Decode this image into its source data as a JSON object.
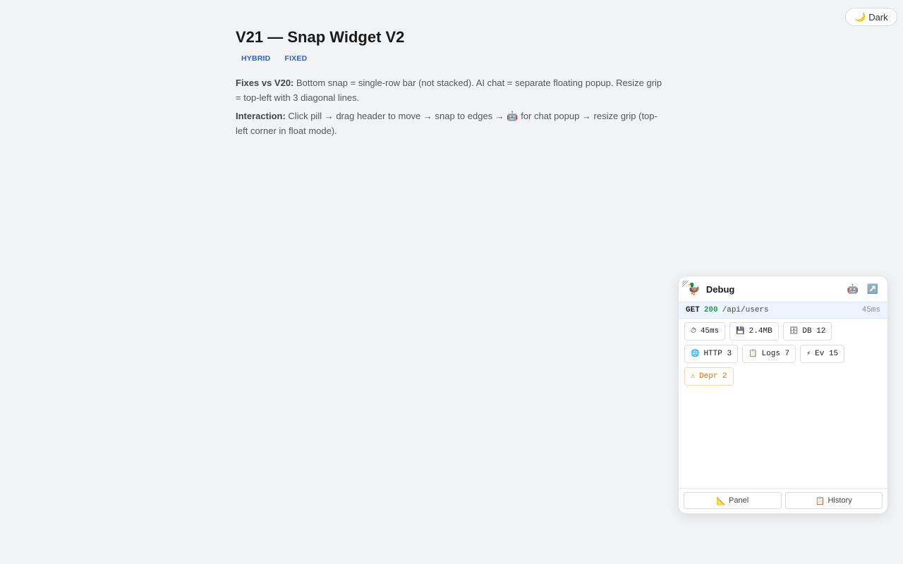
{
  "theme_toggle": {
    "icon": "🌙",
    "label": "Dark"
  },
  "page": {
    "title": "V21 — Snap Widget V2",
    "tags": [
      "HYBRID",
      "FIXED"
    ],
    "fixes": {
      "label": "Fixes vs V20:",
      "text": "Bottom snap = single-row bar (not stacked). AI chat = separate floating popup. Resize grip = top-left with 3 diagonal lines."
    },
    "interaction": {
      "label": "Interaction:",
      "text": "Click pill → drag header to move → snap to edges → 🤖 for chat popup → resize grip (top-left corner in float mode)."
    }
  },
  "widget": {
    "logo": "🦆",
    "title": "Debug",
    "chat_icon": "🤖",
    "popout_icon": "↗️",
    "request": {
      "method": "GET",
      "status": "200",
      "path": "/api/users",
      "time": "45ms"
    },
    "chips": [
      {
        "icon": "⏱",
        "icon_name": "timer-icon",
        "label": "45ms",
        "variant": "normal"
      },
      {
        "icon": "💾",
        "icon_name": "memory-icon",
        "label": "2.4MB",
        "variant": "normal"
      },
      {
        "icon": "🗄",
        "icon_name": "database-icon",
        "label": "DB 12",
        "variant": "normal"
      },
      {
        "icon": "🌐",
        "icon_name": "globe-icon",
        "label": "HTTP 3",
        "variant": "normal"
      },
      {
        "icon": "📋",
        "icon_name": "clipboard-icon",
        "label": "Logs 7",
        "variant": "normal"
      },
      {
        "icon": "⚡",
        "icon_name": "lightning-icon",
        "label": "Ev 15",
        "variant": "normal"
      },
      {
        "icon": "⚠",
        "icon_name": "warning-icon",
        "label": "Depr 2",
        "variant": "warn"
      }
    ],
    "footer": {
      "panel": {
        "icon": "📐",
        "label": "Panel"
      },
      "history": {
        "icon": "📋",
        "label": "History"
      }
    }
  },
  "colors": {
    "background": "#f2f3f5",
    "tag_blue": "#2a62c9",
    "status_green": "#1f9d55",
    "warning_orange": "#d97706",
    "request_row_bg": "#eef4fd"
  }
}
